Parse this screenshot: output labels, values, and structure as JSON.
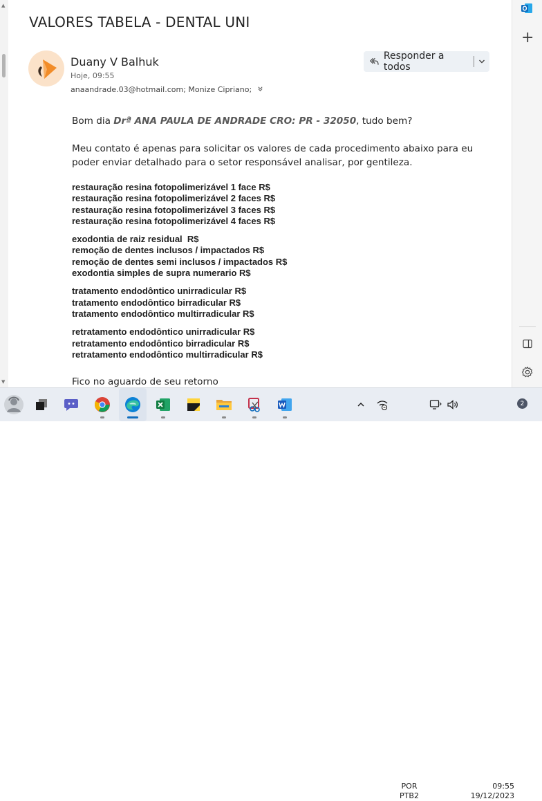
{
  "email": {
    "subject": "VALORES TABELA - DENTAL UNI",
    "sender_name": "Duany V Balhuk",
    "sent_time": "Hoje, 09:55",
    "recipients": "anaandrade.03@hotmail.com; Monize Cipriano;",
    "reply_all_label": "Responder a todos",
    "greeting_prefix": "Bom dia ",
    "greeting_highlight": "Drª ANA PAULA DE ANDRADE CRO: PR - 32050",
    "greeting_suffix": ", tudo bem?",
    "intro": "Meu contato é apenas para solicitar os valores de cada procedimento abaixo para eu poder enviar detalhado para o setor responsável analisar, por gentileza.",
    "procedure_groups": [
      [
        "restauração resina fotopolimerizável 1 face R$",
        "restauração resina fotopolimerizável 2 faces R$",
        "restauração resina fotopolimerizável 3 faces R$",
        "restauração resina fotopolimerizável 4 faces R$"
      ],
      [
        "exodontia de raiz residual  R$",
        "remoção de dentes inclusos / impactados R$",
        "remoção de dentes semi inclusos / impactados R$",
        "exodontia simples de supra numerario R$"
      ],
      [
        "tratamento endodôntico unirradicular R$",
        "tratamento endodôntico birradicular R$",
        "tratamento endodôntico multirradicular R$"
      ],
      [
        "retratamento endodôntico unirradicular R$",
        "retratamento endodôntico birradicular R$",
        "retratamento endodôntico multirradicular R$"
      ]
    ],
    "closing": "Fico no aguardo de seu retorno"
  },
  "icons": {
    "reply_all": "reply-all-icon",
    "dropdown": "chevron-down-icon",
    "expand_recipients": "double-chevron-down-icon",
    "outlook": "outlook-icon",
    "add": "plus-icon",
    "side_panel": "side-panel-icon",
    "settings": "gear-icon"
  },
  "taskbar": {
    "apps": [
      "start-user-icon",
      "task-view-icon",
      "teams-icon",
      "chrome-icon",
      "edge-icon",
      "excel-icon",
      "sticky-notes-icon",
      "file-explorer-icon",
      "snipping-tool-icon",
      "word-icon"
    ],
    "language_top": "POR",
    "language_bottom": "PTB2",
    "time": "09:55",
    "date": "19/12/2023",
    "notification_count": "2"
  },
  "colors": {
    "accent": "#0f6cbd",
    "avatar_bg": "#fbe2c9",
    "avatar_fg": "#f28c28",
    "reply_bg": "#edf1f5",
    "taskbar_bg": "#e9edf3"
  }
}
